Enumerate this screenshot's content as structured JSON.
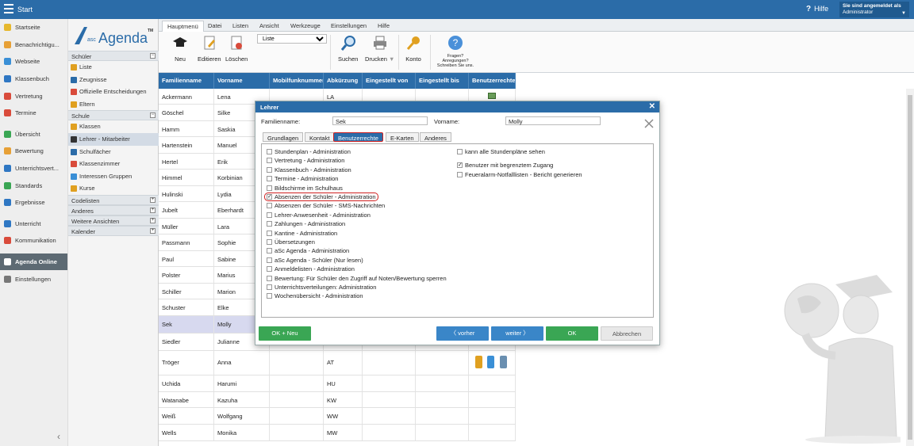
{
  "topbar": {
    "start_label": "Start",
    "help_label": "Hilfe",
    "user_line1": "Sie sind angemeldet als",
    "user_line2": "Administrator"
  },
  "leftnav": {
    "items": [
      {
        "label": "Startseite",
        "color": "#e6b82e"
      },
      {
        "label": "Benachrichtigu...",
        "color": "#e7a036"
      },
      {
        "label": "Webseite",
        "color": "#3a8fd6"
      },
      {
        "label": "Klassenbuch",
        "color": "#2f77c3"
      },
      {
        "label": "Vertretung",
        "color": "#d94b3b"
      },
      {
        "label": "Termine",
        "color": "#d94b3b"
      },
      {
        "label": "Übersicht",
        "color": "#3aa654"
      },
      {
        "label": "Bewertung",
        "color": "#e7a036"
      },
      {
        "label": "Unterrichtsvert...",
        "color": "#2f77c3"
      },
      {
        "label": "Standards",
        "color": "#3aa654"
      },
      {
        "label": "Ergebnisse",
        "color": "#2f77c3"
      },
      {
        "label": "Unterricht",
        "color": "#2f77c3"
      },
      {
        "label": "Kommunikation",
        "color": "#d94b3b"
      },
      {
        "label": "Agenda Online",
        "color": "#ffffff"
      },
      {
        "label": "Einstellungen",
        "color": "#777777"
      }
    ]
  },
  "secnav": {
    "logo_text": "Agenda",
    "logo_prefix": "asc",
    "logo_tm": "TM",
    "schueler_head": "Schüler",
    "schueler_items": [
      "Liste",
      "Zeugnisse",
      "Offizielle Entscheidungen",
      "Eltern"
    ],
    "schule_head": "Schule",
    "schule_items": [
      "Klassen",
      "Lehrer - Mitarbeiter",
      "Schulfächer",
      "Klassenzimmer",
      "Interessen Gruppen",
      "Kurse"
    ],
    "other_heads": [
      "Codelisten",
      "Anderes",
      "Weitere Ansichten",
      "Kalender"
    ]
  },
  "menutabs": [
    "Hauptmenü",
    "Datei",
    "Listen",
    "Ansicht",
    "Werkzeuge",
    "Einstellungen",
    "Hilfe"
  ],
  "toolbar": {
    "new": "Neu",
    "edit": "Editieren",
    "delete": "Löschen",
    "view_select": "Liste",
    "search": "Suchen",
    "print": "Drucken",
    "account": "Konto",
    "feedback": "Fragen? Anregungen? Schreiben Sie uns."
  },
  "table": {
    "headers": [
      "Familienname",
      "Vorname",
      "Mobilfunknummer",
      "Abkürzung",
      "Eingestellt von",
      "Eingestellt bis",
      "Benutzerrechte"
    ],
    "rows": [
      [
        "Ackermann",
        "Lena",
        "LA"
      ],
      [
        "Göschel",
        "Silke",
        ""
      ],
      [
        "Hamm",
        "Saskia",
        ""
      ],
      [
        "Hartenstein",
        "Manuel",
        ""
      ],
      [
        "Hertel",
        "Erik",
        ""
      ],
      [
        "Himmel",
        "Korbinian",
        ""
      ],
      [
        "Hulinski",
        "Lydia",
        ""
      ],
      [
        "Jubelt",
        "Eberhardt",
        ""
      ],
      [
        "Müller",
        "Lara",
        ""
      ],
      [
        "Passmann",
        "Sophie",
        ""
      ],
      [
        "Paul",
        "Sabine",
        ""
      ],
      [
        "Polster",
        "Marius",
        ""
      ],
      [
        "Schiller",
        "Marion",
        ""
      ],
      [
        "Schuster",
        "Elke",
        ""
      ],
      [
        "Sek",
        "Molly",
        ""
      ],
      [
        "Siedler",
        "Julianne",
        ""
      ],
      [
        "Tröger",
        "Anna",
        "AT"
      ],
      [
        "Uchida",
        "Harumi",
        "HU"
      ],
      [
        "Watanabe",
        "Kazuha",
        "KW"
      ],
      [
        "Weiß",
        "Wolfgang",
        "WW"
      ],
      [
        "Wells",
        "Monika",
        "MW"
      ]
    ]
  },
  "dialog": {
    "title": "Lehrer",
    "lastname_label": "Familienname:",
    "lastname_value": "Sek",
    "firstname_label": "Vorname:",
    "firstname_value": "Molly",
    "tabs": [
      "Grundlagen",
      "Kontakt",
      "Benutzerrechte",
      "E-Karten",
      "Anderes"
    ],
    "left_rights": [
      {
        "label": "Stundenplan - Administration",
        "checked": false
      },
      {
        "label": "Vertretung - Administration",
        "checked": false
      },
      {
        "label": "Klassenbuch - Administration",
        "checked": false
      },
      {
        "label": "Termine - Administration",
        "checked": false
      },
      {
        "label": "Bildschirme im Schulhaus",
        "checked": false
      },
      {
        "label": "Absenzen der Schüler - Administration",
        "checked": true
      },
      {
        "label": "Absenzen der Schüler - SMS-Nachrichten",
        "checked": false
      },
      {
        "label": "Lehrer-Anwesenheit - Administration",
        "checked": false
      },
      {
        "label": "Zahlungen - Administration",
        "checked": false
      },
      {
        "label": "Kantine - Administration",
        "checked": false
      },
      {
        "label": "Übersetzungen",
        "checked": false
      },
      {
        "label": "aSc Agenda - Administration",
        "checked": false
      },
      {
        "label": "aSc Agenda - Schüler (Nur lesen)",
        "checked": false
      },
      {
        "label": "Anmeldelisten - Administration",
        "checked": false
      },
      {
        "label": "Bewertung: Für Schüler den Zugriff auf Noten/Bewertung sperren",
        "checked": false
      },
      {
        "label": "Unterrichtsverteilungen: Administration",
        "checked": false
      },
      {
        "label": "Wochenübersicht - Administration",
        "checked": false
      }
    ],
    "right_rights": [
      {
        "label": "kann alle Stundenpläne sehen",
        "checked": false
      },
      {
        "label": "Benutzer mit begrenztem Zugang",
        "checked": true
      },
      {
        "label": "Feueralarm-Notfalllisten - Bericht generieren",
        "checked": false
      }
    ],
    "btn_ok_new": "OK + Neu",
    "btn_prev": "vorher",
    "btn_next": "weiter",
    "btn_ok": "OK",
    "btn_cancel": "Abbrechen"
  },
  "colors": {
    "accent": "#2b6ca8",
    "green": "#3aa654",
    "highlight_red": "#d02020"
  }
}
